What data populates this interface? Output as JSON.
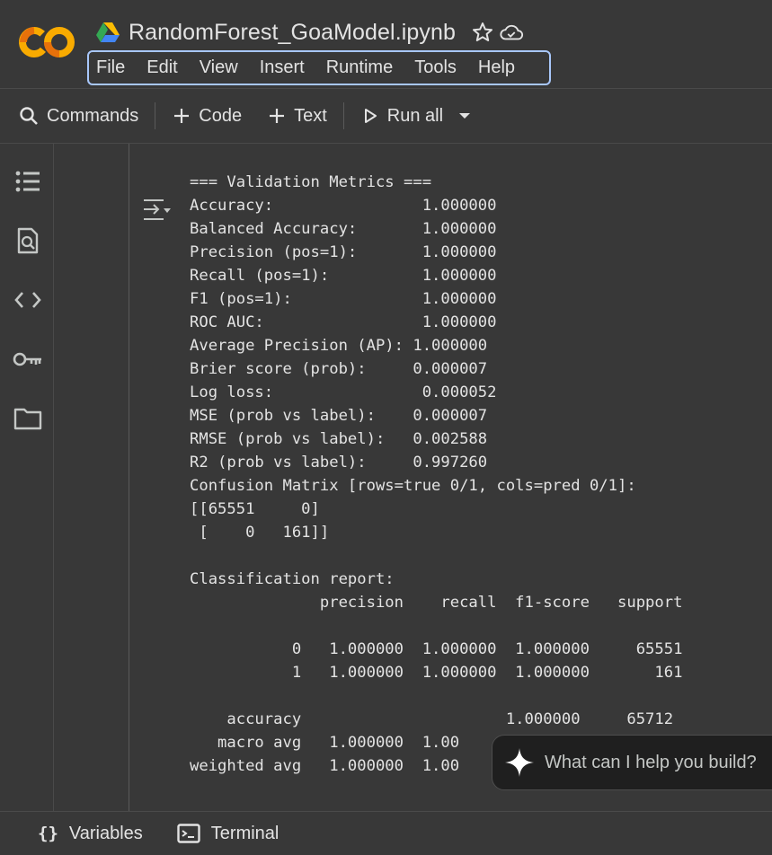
{
  "header": {
    "logo_text": "CO",
    "title": "RandomForest_GoaModel.ipynb",
    "icons": [
      "google-drive-icon",
      "star-icon",
      "cloud-check-icon"
    ]
  },
  "menu": {
    "items": [
      "File",
      "Edit",
      "View",
      "Insert",
      "Runtime",
      "Tools",
      "Help"
    ]
  },
  "toolbar": {
    "commands": "Commands",
    "code": "Code",
    "text": "Text",
    "run_all": "Run all"
  },
  "sidebar": {
    "icons": [
      "table-of-contents-icon",
      "find-replace-icon",
      "code-snippets-icon",
      "secrets-key-icon",
      "files-folder-icon"
    ]
  },
  "output": {
    "lines": [
      "=== Validation Metrics ===",
      "Accuracy:                1.000000",
      "Balanced Accuracy:       1.000000",
      "Precision (pos=1):       1.000000",
      "Recall (pos=1):          1.000000",
      "F1 (pos=1):              1.000000",
      "ROC AUC:                 1.000000",
      "Average Precision (AP): 1.000000",
      "Brier score (prob):     0.000007",
      "Log loss:                0.000052",
      "MSE (prob vs label):    0.000007",
      "RMSE (prob vs label):   0.002588",
      "R2 (prob vs label):     0.997260",
      "Confusion Matrix [rows=true 0/1, cols=pred 0/1]:",
      "[[65551     0]",
      " [    0   161]]",
      "",
      "Classification report:",
      "              precision    recall  f1-score   support",
      "",
      "           0   1.000000  1.000000  1.000000     65551",
      "           1   1.000000  1.000000  1.000000       161",
      "",
      "    accuracy                      1.000000     65712",
      "   macro avg   1.000000  1.00",
      "weighted avg   1.000000  1.00"
    ]
  },
  "assistant_chip": {
    "text": "What can I help you build?"
  },
  "bottombar": {
    "variables": "Variables",
    "variables_glyph": "{}",
    "terminal": "Terminal"
  }
}
